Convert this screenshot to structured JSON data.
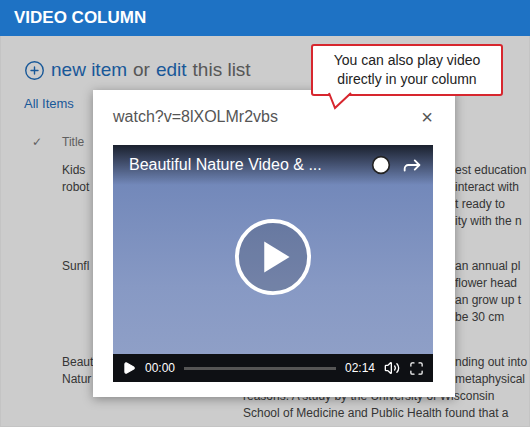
{
  "header": {
    "title": "VIDEO COLUMN"
  },
  "toolbar": {
    "new_item": "new item",
    "or": "or",
    "edit": "edit",
    "this_list": "this list"
  },
  "view": {
    "label": "All Items"
  },
  "list": {
    "check_header": "✓",
    "title_header": "Title",
    "rows": [
      {
        "title": "Kids robot",
        "lines": [
          {
            "text": "est education",
            "kind": "partial"
          },
          {
            "text": "interact with",
            "kind": "partial"
          },
          {
            "text": "t ready to",
            "kind": "partial"
          },
          {
            "text": "ity with the n",
            "kind": "partial"
          }
        ]
      },
      {
        "title": "Sunfl",
        "lines": [
          {
            "text": "an annual pl",
            "kind": "partial"
          },
          {
            "text": "flower head",
            "kind": "partial"
          },
          {
            "text": "an grow up t",
            "kind": "partial"
          },
          {
            "text": "be 30 cm",
            "kind": "partial"
          }
        ]
      },
      {
        "title": "Beaut Natur",
        "lines": [
          {
            "text": "nding out into",
            "kind": "partial"
          },
          {
            "text": "metaphysical",
            "kind": "partial"
          },
          {
            "text": "reasons. A study by the University of Wisconsin",
            "kind": "whole"
          },
          {
            "text": "School of Medicine and Public Health found that a",
            "kind": "whole"
          }
        ]
      }
    ]
  },
  "dialog": {
    "title": "watch?v=8lXOLMr2vbs",
    "close": "×",
    "video": {
      "title": "Beautiful Nature Video & ...",
      "current_time": "00:00",
      "duration": "02:14",
      "level": 0
    }
  },
  "callout": {
    "text": "You can also play video directly in your column"
  }
}
